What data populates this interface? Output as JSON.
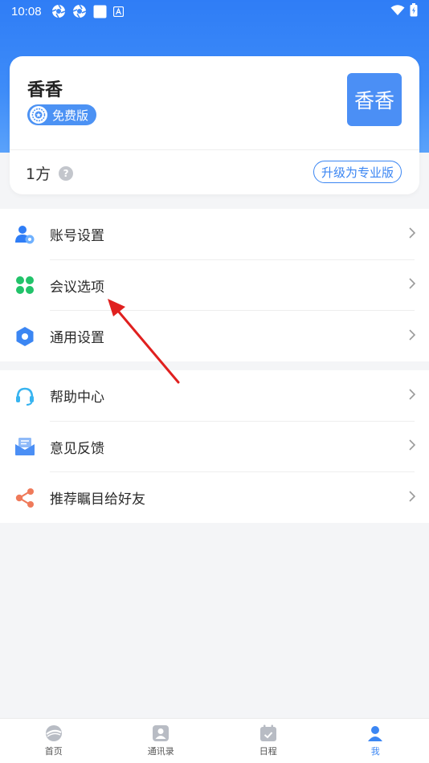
{
  "status_bar": {
    "time": "10:08",
    "icons": [
      "aperture-icon",
      "aperture-icon",
      "square-icon",
      "a-badge-icon"
    ],
    "right_icons": [
      "wifi-icon",
      "battery-icon"
    ]
  },
  "profile": {
    "name": "香香",
    "badge_label": "免费版",
    "avatar_text": "香香",
    "plan_value": "1方",
    "upgrade_label": "升级为专业版"
  },
  "menu_group_1": [
    {
      "label": "账号设置",
      "icon": "user-settings-icon",
      "color": "#2f7df6"
    },
    {
      "label": "会议选项",
      "icon": "clover-icon",
      "color": "#22c36a"
    },
    {
      "label": "通用设置",
      "icon": "hex-gear-icon",
      "color": "#3b86f3"
    }
  ],
  "menu_group_2": [
    {
      "label": "帮助中心",
      "icon": "headset-icon",
      "color": "#38b4f0"
    },
    {
      "label": "意见反馈",
      "icon": "feedback-mail-icon",
      "color": "#4b8ff5"
    },
    {
      "label": "推荐瞩目给好友",
      "icon": "share-icon",
      "color": "#ef7a5a"
    }
  ],
  "tabbar": [
    {
      "label": "首页",
      "icon": "home-logo-icon"
    },
    {
      "label": "通讯录",
      "icon": "contacts-icon"
    },
    {
      "label": "日程",
      "icon": "calendar-icon"
    },
    {
      "label": "我",
      "icon": "me-icon"
    }
  ],
  "colors": {
    "brand": "#2f7df6",
    "annotation_arrow": "#e0201f"
  }
}
